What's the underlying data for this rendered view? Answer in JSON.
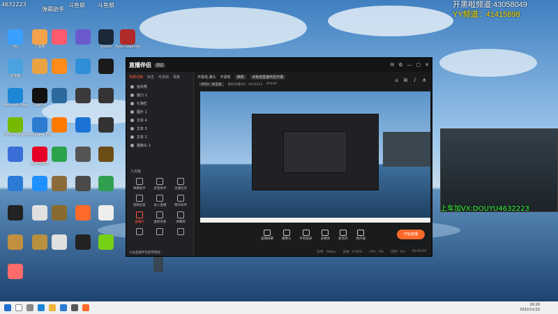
{
  "overlay": {
    "line1": "开黑啦频道:43058049",
    "line2": "YY频道：41415898",
    "cam_text": "上车加VX:DOUYU4632223",
    "badges": [
      "4632223",
      "弹幕助手",
      "斗鱼娘",
      "斗鱼娘"
    ]
  },
  "desktop": {
    "icons": [
      {
        "label": "QQ",
        "color": "#3aa0ff"
      },
      {
        "label": "斗鱼娘",
        "color": "#f2a24a"
      },
      {
        "label": "",
        "color": "#ff5a6e"
      },
      {
        "label": "",
        "color": "#6a5acd"
      },
      {
        "label": "Steam",
        "color": "#1b2838"
      },
      {
        "label": "Apex Legends",
        "color": "#b02a2a"
      },
      {
        "label": "此电脑",
        "color": "#4aa3df"
      },
      {
        "label": "",
        "color": "#e9a343"
      },
      {
        "label": "",
        "color": "#ff8c1a"
      },
      {
        "label": "",
        "color": "#2f8fd8"
      },
      {
        "label": "",
        "color": "#1a1a1a"
      },
      {
        "label": "Microsoft Edge",
        "color": "#1d86d6"
      },
      {
        "label": "CapCut",
        "color": "#111"
      },
      {
        "label": "",
        "color": "#2c6a9e"
      },
      {
        "label": "",
        "color": "#3b3b3b"
      },
      {
        "label": "",
        "color": "#333"
      },
      {
        "label": "GeForce Experience",
        "color": "#76b900"
      },
      {
        "label": "Wallpaper Engine",
        "color": "#2b7bd1"
      },
      {
        "label": "",
        "color": "#ff7b00"
      },
      {
        "label": "",
        "color": "#1b73d6"
      },
      {
        "label": "",
        "color": "#333"
      },
      {
        "label": "",
        "color": "#3b6fd8"
      },
      {
        "label": "网易云音乐",
        "color": "#e60026"
      },
      {
        "label": "",
        "color": "#2aa34a"
      },
      {
        "label": "",
        "color": "#555"
      },
      {
        "label": "",
        "color": "#6b4e16"
      },
      {
        "label": "",
        "color": "#2a7ad6"
      },
      {
        "label": "",
        "color": "#1e90ff"
      },
      {
        "label": "",
        "color": "#8b6a3c"
      },
      {
        "label": "",
        "color": "#4a4a4a"
      },
      {
        "label": "",
        "color": "#30a050"
      },
      {
        "label": "",
        "color": "#222"
      },
      {
        "label": "",
        "color": "#e0e0e0"
      },
      {
        "label": "",
        "color": "#8a6b2f"
      },
      {
        "label": "",
        "color": "#ff6a2a"
      },
      {
        "label": "",
        "color": "#eeeeee"
      },
      {
        "label": "",
        "color": "#c09040"
      },
      {
        "label": "",
        "color": "#b89040"
      },
      {
        "label": "",
        "color": "#e0e0e0"
      },
      {
        "label": "",
        "color": "#222"
      },
      {
        "label": "",
        "color": "#76d016"
      },
      {
        "label": "",
        "color": "#ff6a6a"
      }
    ]
  },
  "app": {
    "logo": "直播伴侣",
    "version": "测试",
    "left_tabs": [
      "场景切换",
      "双击",
      "可添加",
      "场景"
    ],
    "scenes": [
      "钻石秀",
      "窗口 1",
      "礼物栏",
      "图片 1",
      "文本 4",
      "文本 3",
      "文本 2",
      "摄像头 1"
    ],
    "tools_header": "工具箱",
    "tools": [
      "弹幕助手",
      "房管助手",
      "主播任务",
      "视频连麦",
      "录入直播",
      "精华助手",
      "直播间",
      "虚拟形象",
      "弹幕秀",
      "",
      "",
      ""
    ],
    "left_footer": "斗鱼直播伴侣使用教程",
    "main_tabs": [
      "开黑啦,爆头",
      "开黑啦",
      "推荐",
      "#我用直播伴侣开播"
    ],
    "sub": [
      "APEX · 射击类",
      "虚拟主播QQ：4632223",
      "85440"
    ],
    "controls": [
      "直播屏幕",
      "摄像头",
      "手机投屏",
      "多媒体",
      "麦克风",
      "扬声器"
    ],
    "go_live": "开始直播",
    "status": [
      "码率：0kbps",
      "丢帧：0.00%",
      "CPU：0%",
      "内存：0%",
      "00:00:00"
    ]
  },
  "clock": {
    "time": "20:20",
    "date": "2022/11/13"
  }
}
